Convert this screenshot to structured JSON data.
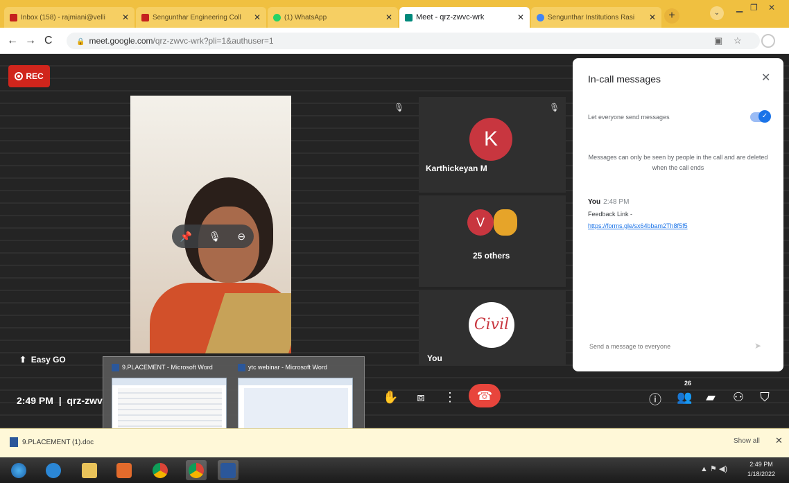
{
  "browser": {
    "tabs": [
      {
        "label": "Inbox (158) - rajmiani@velli",
        "active": false,
        "color": "#c5221f"
      },
      {
        "label": "Sengunthar Engineering Coll",
        "active": false,
        "color": "#c5221f"
      },
      {
        "label": "(1) WhatsApp",
        "active": false,
        "color": "#25d366"
      },
      {
        "label": "Meet - qrz-zwvc-wrk",
        "active": true,
        "color": "#00897b"
      },
      {
        "label": "Sengunthar Institutions Rasi",
        "active": false,
        "color": "#4285f4"
      }
    ],
    "new_tab": "+",
    "url_host": "meet.google.com",
    "url_path": "/qrz-zwvc-wrk?pli=1&authuser=1"
  },
  "meet": {
    "rec_label": "REC",
    "participants": [
      {
        "name": "Karthickeyan M",
        "initial": "K",
        "color": "#c8363f"
      },
      {
        "name": "25 others",
        "initial": "V",
        "color": "#c8363f"
      },
      {
        "name": "You",
        "initial": "Civil",
        "color": "#ffffff"
      }
    ],
    "presenter_label": "Easy GO",
    "time": "2:49 PM",
    "meeting_code": "qrz-zwv",
    "people_count": "26"
  },
  "panel": {
    "title": "In-call messages",
    "toggle_label": "Let everyone send messages",
    "note": "Messages can only be seen by people in the call and are deleted when the call ends",
    "sender": "You",
    "sent_time": "2:48 PM",
    "message": "Feedback Link -",
    "link": "https://forms.gle/sx64bbam2Th8f5f5",
    "input_placeholder": "Send a message to everyone"
  },
  "preview": {
    "windows": [
      {
        "title": "9.PLACEMENT - Microsoft Word"
      },
      {
        "title": "ytc webinar - Microsoft Word"
      }
    ]
  },
  "downloads": {
    "file": "9.PLACEMENT (1).doc",
    "show_all": "Show all"
  },
  "taskbar": {
    "time": "2:49 PM",
    "date": "1/18/2022"
  }
}
